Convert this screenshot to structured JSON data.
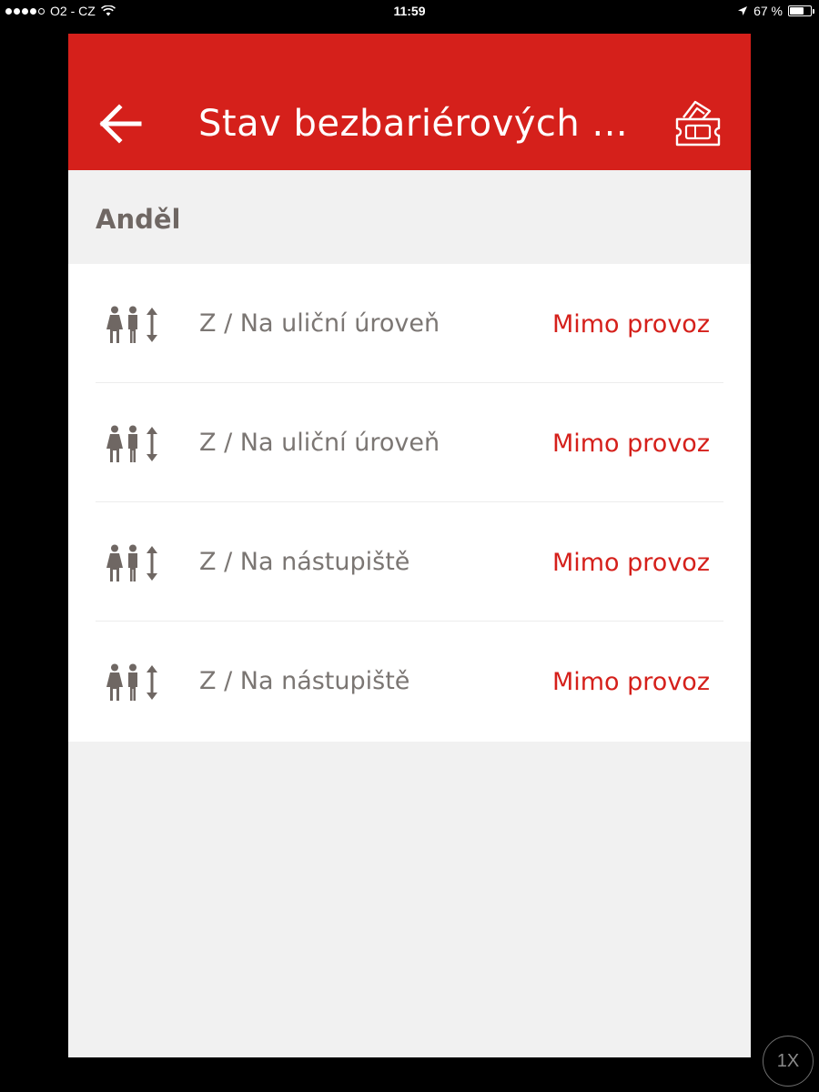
{
  "status_bar": {
    "carrier": "O2 - CZ",
    "time": "11:59",
    "battery": "67 %",
    "battery_level": 0.67
  },
  "header": {
    "title": "Stav bezbariérových ...",
    "back_icon": "arrow-left-icon",
    "tickets_icon": "tickets-icon"
  },
  "station": {
    "name": "Anděl"
  },
  "rows": [
    {
      "label": "Z / Na uliční úroveň",
      "status": "Mimo provoz",
      "icon": "elevator-icon"
    },
    {
      "label": "Z / Na uliční úroveň",
      "status": "Mimo provoz",
      "icon": "elevator-icon"
    },
    {
      "label": "Z / Na nástupiště",
      "status": "Mimo provoz",
      "icon": "elevator-icon"
    },
    {
      "label": "Z / Na nástupiště",
      "status": "Mimo provoz",
      "icon": "elevator-icon"
    }
  ],
  "speed_button": {
    "label": "1X"
  },
  "colors": {
    "brand_red": "#d5201b",
    "icon_gray": "#6f6763",
    "background": "#f1f1f1"
  }
}
